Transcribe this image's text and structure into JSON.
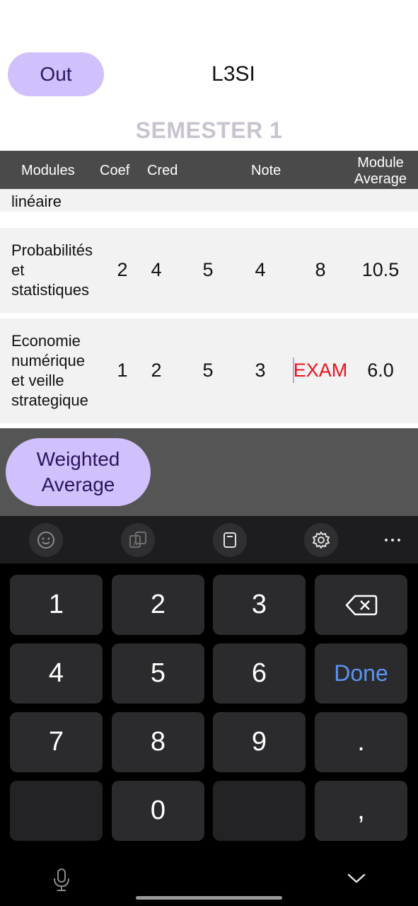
{
  "header": {
    "out_label": "Out",
    "title": "L3SI",
    "semester": "SEMESTER 1"
  },
  "table": {
    "columns": {
      "modules": "Modules",
      "coef": "Coef",
      "cred": "Cred",
      "note": "Note",
      "module_average_line1": "Module",
      "module_average_line2": "Average"
    },
    "rows": [
      {
        "name_lines": [
          "linéaire"
        ]
      },
      {
        "name_lines": [
          "Probabilités",
          "et",
          "statistiques"
        ],
        "coef": "2",
        "cred": "4",
        "v1": "5",
        "v2": "4",
        "v3": "8",
        "average": "10.5"
      },
      {
        "name_lines": [
          "Economie",
          "numérique",
          "et veille",
          "strategique"
        ],
        "coef": "1",
        "cred": "2",
        "v1": "5",
        "v2": "3",
        "exam_placeholder": "EXAM",
        "average": "6.0"
      }
    ]
  },
  "actions": {
    "weighted_average_line1": "Weighted",
    "weighted_average_line2": "Average"
  },
  "keyboard": {
    "toolbar": [
      "emoji-icon",
      "translate-icon",
      "clipboard-icon",
      "gear-icon",
      "more-icon"
    ],
    "keys": {
      "k1": "1",
      "k2": "2",
      "k3": "3",
      "k4": "4",
      "k5": "5",
      "k6": "6",
      "k7": "7",
      "k8": "8",
      "k9": "9",
      "k0": "0",
      "dot": ".",
      "comma": ",",
      "done": "Done"
    }
  },
  "colors": {
    "accent_button": "#d0c0fb",
    "header_bar": "#4a4a4a",
    "exam_text": "#e8141c",
    "done_key": "#5b94f2"
  }
}
